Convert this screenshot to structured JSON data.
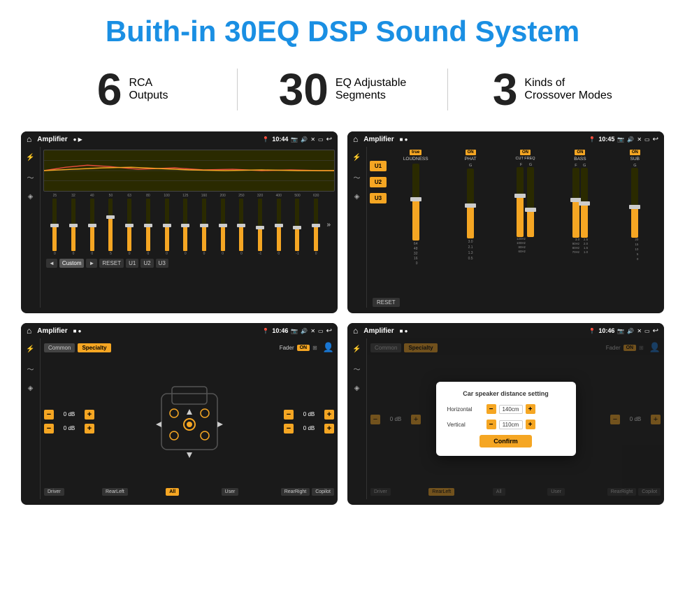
{
  "header": {
    "title": "Buith-in 30EQ DSP Sound System"
  },
  "stats": [
    {
      "number": "6",
      "label_line1": "RCA",
      "label_line2": "Outputs"
    },
    {
      "number": "30",
      "label_line1": "EQ Adjustable",
      "label_line2": "Segments"
    },
    {
      "number": "3",
      "label_line1": "Kinds of",
      "label_line2": "Crossover Modes"
    }
  ],
  "screens": {
    "eq": {
      "title": "Amplifier",
      "time": "10:44",
      "freqs": [
        "25",
        "32",
        "40",
        "50",
        "63",
        "80",
        "100",
        "125",
        "160",
        "200",
        "250",
        "320",
        "400",
        "500",
        "630"
      ],
      "values": [
        "0",
        "0",
        "0",
        "5",
        "0",
        "0",
        "0",
        "0",
        "0",
        "0",
        "0",
        "-1",
        "0",
        "-1"
      ],
      "buttons": [
        "Custom",
        "RESET",
        "U1",
        "U2",
        "U3"
      ]
    },
    "crossover": {
      "title": "Amplifier",
      "time": "10:45",
      "u_buttons": [
        "U1",
        "U2",
        "U3"
      ],
      "cols": [
        {
          "on": true,
          "label": "LOUDNESS"
        },
        {
          "on": true,
          "label": "PHAT"
        },
        {
          "on": true,
          "label": "CUT FREQ"
        },
        {
          "on": true,
          "label": "BASS"
        },
        {
          "on": true,
          "label": "SUB"
        }
      ],
      "reset": "RESET"
    },
    "fader": {
      "title": "Amplifier",
      "time": "10:46",
      "tabs": [
        "Common",
        "Specialty"
      ],
      "fader_label": "Fader",
      "on_label": "ON",
      "db_values": [
        "0 dB",
        "0 dB",
        "0 dB",
        "0 dB"
      ],
      "bottom_btns": [
        "Driver",
        "RearLeft",
        "All",
        "User",
        "RearRight",
        "Copilot"
      ]
    },
    "distance": {
      "title": "Amplifier",
      "time": "10:46",
      "tabs": [
        "Common",
        "Specialty"
      ],
      "dialog": {
        "title": "Car speaker distance setting",
        "horizontal_label": "Horizontal",
        "horizontal_value": "140cm",
        "vertical_label": "Vertical",
        "vertical_value": "110cm",
        "confirm_btn": "Confirm"
      },
      "db_values": [
        "0 dB",
        "0 dB"
      ],
      "bottom_btns": [
        "Driver",
        "RearLeft",
        "All",
        "User",
        "RearRight",
        "Copilot"
      ]
    }
  },
  "icons": {
    "home": "⌂",
    "back": "↩",
    "location": "📍",
    "camera": "📷",
    "volume": "🔊",
    "eq_icon": "⚡",
    "wave": "〜",
    "speaker": "📢"
  }
}
